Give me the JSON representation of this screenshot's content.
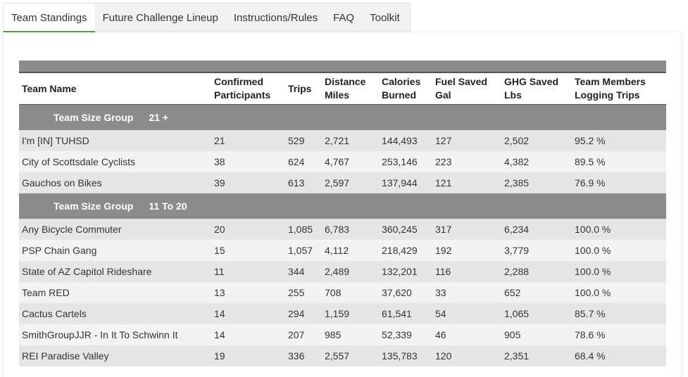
{
  "tabs": [
    {
      "label": "Team Standings",
      "active": true
    },
    {
      "label": "Future Challenge Lineup",
      "active": false
    },
    {
      "label": "Instructions/Rules",
      "active": false
    },
    {
      "label": "FAQ",
      "active": false
    },
    {
      "label": "Toolkit",
      "active": false
    }
  ],
  "table": {
    "headers": {
      "team_name": "Team Name",
      "confirmed": "Confirmed Participants",
      "trips": "Trips",
      "distance": "Distance Miles",
      "calories": "Calories Burned",
      "fuel": "Fuel Saved Gal",
      "ghg": "GHG Saved Lbs",
      "logging": "Team Members Logging Trips"
    },
    "groups": [
      {
        "label": "Team Size Group",
        "range": "21 +",
        "rows": [
          {
            "name": "I'm [IN] TUHSD",
            "confirmed": "21",
            "trips": "529",
            "distance": "2,721",
            "calories": "144,493",
            "fuel": "127",
            "ghg": "2,502",
            "logging": "95.2 %"
          },
          {
            "name": "City of Scottsdale Cyclists",
            "confirmed": "38",
            "trips": "624",
            "distance": "4,767",
            "calories": "253,146",
            "fuel": "223",
            "ghg": "4,382",
            "logging": "89.5 %"
          },
          {
            "name": "Gauchos on Bikes",
            "confirmed": "39",
            "trips": "613",
            "distance": "2,597",
            "calories": "137,944",
            "fuel": "121",
            "ghg": "2,385",
            "logging": "76.9 %"
          }
        ]
      },
      {
        "label": "Team Size Group",
        "range": "11 To 20",
        "rows": [
          {
            "name": "Any Bicycle Commuter",
            "confirmed": "20",
            "trips": "1,085",
            "distance": "6,783",
            "calories": "360,245",
            "fuel": "317",
            "ghg": "6,234",
            "logging": "100.0 %"
          },
          {
            "name": "PSP Chain Gang",
            "confirmed": "15",
            "trips": "1,057",
            "distance": "4,112",
            "calories": "218,429",
            "fuel": "192",
            "ghg": "3,779",
            "logging": "100.0 %"
          },
          {
            "name": "State of AZ Capitol Rideshare",
            "confirmed": "11",
            "trips": "344",
            "distance": "2,489",
            "calories": "132,201",
            "fuel": "116",
            "ghg": "2,288",
            "logging": "100.0 %"
          },
          {
            "name": "Team RED",
            "confirmed": "13",
            "trips": "255",
            "distance": "708",
            "calories": "37,620",
            "fuel": "33",
            "ghg": "652",
            "logging": "100.0 %"
          },
          {
            "name": "Cactus Cartels",
            "confirmed": "14",
            "trips": "294",
            "distance": "1,159",
            "calories": "61,541",
            "fuel": "54",
            "ghg": "1,065",
            "logging": "85.7 %"
          },
          {
            "name": "SmithGroupJJR - In It To Schwinn It",
            "confirmed": "14",
            "trips": "207",
            "distance": "985",
            "calories": "52,339",
            "fuel": "46",
            "ghg": "905",
            "logging": "78.6 %"
          },
          {
            "name": "REI Paradise Valley",
            "confirmed": "19",
            "trips": "336",
            "distance": "2,557",
            "calories": "135,783",
            "fuel": "120",
            "ghg": "2,351",
            "logging": "68.4 %"
          }
        ]
      }
    ]
  },
  "colors": {
    "accent_underline": "#5aa02c",
    "group_bar": "#8c8c8c",
    "row_shade": "#e6e6e6",
    "row_plain": "#f3f3f3"
  }
}
